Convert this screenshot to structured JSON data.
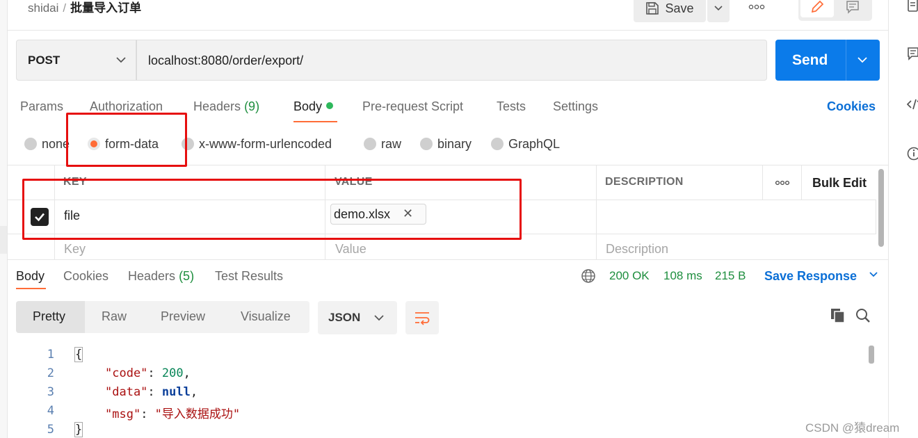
{
  "breadcrumb": {
    "workspace": "shidai",
    "separator": "/",
    "request_name": "批量导入订单"
  },
  "header": {
    "save_label": "Save",
    "more_label": "ooo"
  },
  "request": {
    "method": "POST",
    "url": "localhost:8080/order/export/",
    "send_label": "Send"
  },
  "request_tabs": [
    {
      "label": "Params"
    },
    {
      "label": "Authorization"
    },
    {
      "label": "Headers",
      "count": "(9)"
    },
    {
      "label": "Body"
    },
    {
      "label": "Pre-request Script"
    },
    {
      "label": "Tests"
    },
    {
      "label": "Settings"
    }
  ],
  "cookies_label": "Cookies",
  "body_types": [
    "none",
    "form-data",
    "x-www-form-urlencoded",
    "raw",
    "binary",
    "GraphQL"
  ],
  "body_type_selected": "form-data",
  "params_table": {
    "headers": {
      "key": "KEY",
      "value": "VALUE",
      "description": "DESCRIPTION",
      "more": "ooo",
      "bulk_edit": "Bulk Edit"
    },
    "rows": [
      {
        "key": "file",
        "value": "demo.xlsx",
        "remove": "✕"
      }
    ],
    "placeholders": {
      "key": "Key",
      "value": "Value",
      "description": "Description"
    }
  },
  "response_tabs": [
    {
      "label": "Body"
    },
    {
      "label": "Cookies"
    },
    {
      "label": "Headers",
      "count": "(5)"
    },
    {
      "label": "Test Results"
    }
  ],
  "response_status": {
    "status": "200 OK",
    "time": "108 ms",
    "size": "215 B"
  },
  "save_response_label": "Save Response",
  "view_modes": [
    "Pretty",
    "Raw",
    "Preview",
    "Visualize"
  ],
  "format": "JSON",
  "code": {
    "line_numbers": [
      "1",
      "2",
      "3",
      "4",
      "5"
    ],
    "open_brace": "{",
    "close_brace": "}",
    "fields": [
      {
        "key": "\"code\"",
        "colon": ": ",
        "value": "200",
        "comma": ","
      },
      {
        "key": "\"data\"",
        "colon": ": ",
        "value": "null",
        "comma": ","
      },
      {
        "key": "\"msg\"",
        "colon": ": ",
        "value": "\"导入数据成功\"",
        "comma": ""
      }
    ]
  },
  "watermark": "CSDN @猿dream",
  "colors": {
    "accent": "#ff6c37",
    "send": "#0b7bea",
    "link": "#0b6fd6",
    "success": "#1e8e3e",
    "annotation": "#e60f0f"
  }
}
